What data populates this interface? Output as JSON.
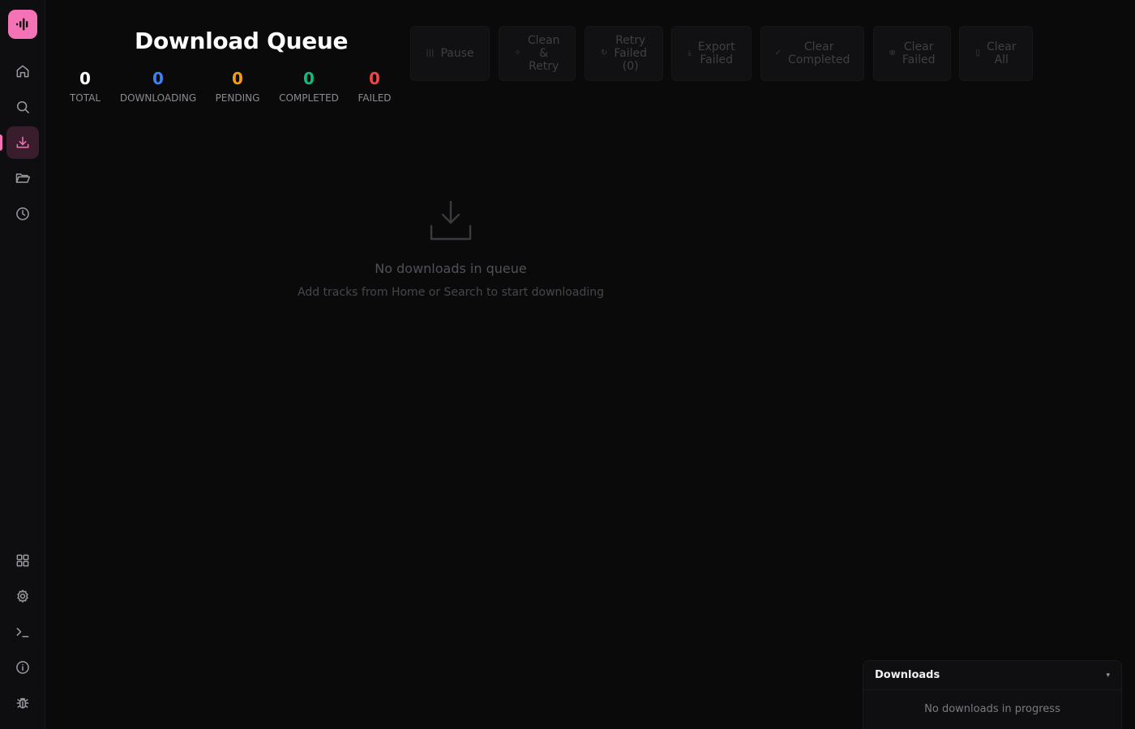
{
  "colors": {
    "accent": "#f472b6",
    "total": "#ffffff",
    "downloading": "#3b82f6",
    "pending": "#f59e0b",
    "completed": "#10b981",
    "failed": "#ef4444"
  },
  "sidebar": {
    "logo": "waveform-logo-icon",
    "top_items": [
      {
        "name": "home",
        "icon": "home-icon",
        "active": false
      },
      {
        "name": "search",
        "icon": "search-icon",
        "active": false
      },
      {
        "name": "downloads",
        "icon": "download-icon",
        "active": true
      },
      {
        "name": "files",
        "icon": "folder-open-icon",
        "active": false
      },
      {
        "name": "history",
        "icon": "clock-icon",
        "active": false
      }
    ],
    "bottom_items": [
      {
        "name": "apps",
        "icon": "grid-icon"
      },
      {
        "name": "settings",
        "icon": "gear-icon"
      },
      {
        "name": "terminal",
        "icon": "terminal-icon"
      },
      {
        "name": "about",
        "icon": "info-icon"
      },
      {
        "name": "debug",
        "icon": "bug-icon"
      }
    ]
  },
  "header": {
    "title": "Download Queue",
    "stats": {
      "total": {
        "value": "0",
        "label": "TOTAL"
      },
      "downloading": {
        "value": "0",
        "label": "DOWNLOADING"
      },
      "pending": {
        "value": "0",
        "label": "PENDING"
      },
      "completed": {
        "value": "0",
        "label": "COMPLETED"
      },
      "failed": {
        "value": "0",
        "label": "FAILED"
      }
    }
  },
  "toolbar": {
    "pause": {
      "label": "Pause",
      "icon": "pause-icon"
    },
    "clean_retry": {
      "line1": "Clean",
      "line2": "&",
      "line3": "Retry",
      "icon": "sparkle-icon"
    },
    "retry_failed": {
      "line1": "Retry",
      "line2": "Failed",
      "line3": "(0)",
      "icon": "refresh-icon"
    },
    "export_failed": {
      "line1": "Export",
      "line2": "Failed",
      "icon": "export-icon"
    },
    "clear_completed": {
      "line1": "Clear",
      "line2": "Completed",
      "icon": "check-icon"
    },
    "clear_failed": {
      "line1": "Clear",
      "line2": "Failed",
      "icon": "x-circle-icon"
    },
    "clear_all": {
      "line1": "Clear",
      "line2": "All",
      "icon": "trash-icon"
    }
  },
  "empty_state": {
    "icon": "download-tray-icon",
    "title": "No downloads in queue",
    "subtitle": "Add tracks from Home or Search to start downloading"
  },
  "downloads_panel": {
    "title": "Downloads",
    "toggle": "▾",
    "message": "No downloads in progress"
  }
}
